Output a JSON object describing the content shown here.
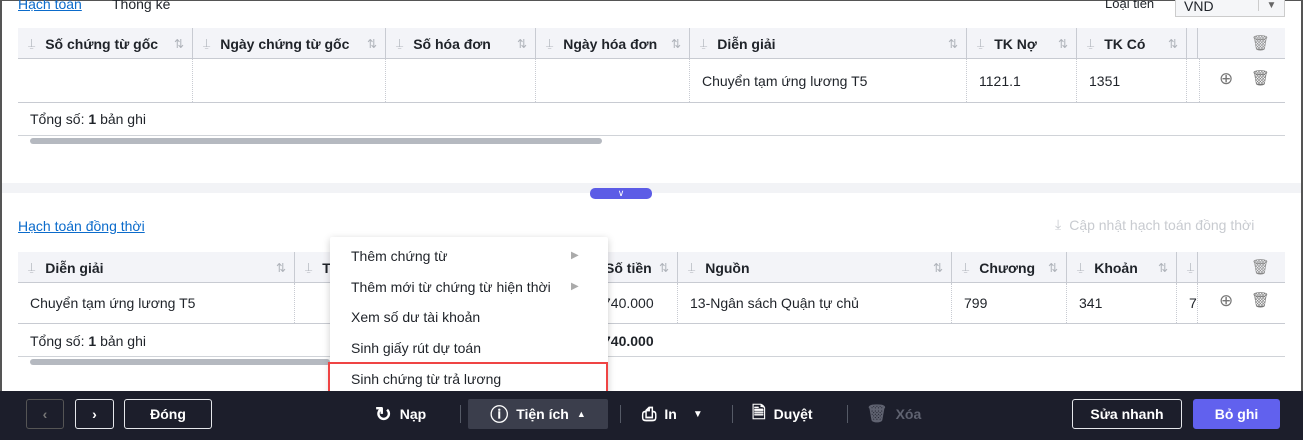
{
  "top": {
    "tabs": [
      "Hạch toán",
      "Thống kê"
    ],
    "currency_label": "Loại tiền",
    "currency_value": "VND",
    "columns": [
      "Số chứng từ gốc",
      "Ngày chứng từ gốc",
      "Số hóa đơn",
      "Ngày hóa đơn",
      "Diễn giải",
      "TK Nợ",
      "TK Có"
    ],
    "row": {
      "dien_giai": "Chuyển tạm ứng lương T5",
      "tk_no": "1121.1",
      "tk_co": "1351"
    },
    "footer_prefix": "Tổng số:",
    "footer_count": "1",
    "footer_suffix": "bản ghi"
  },
  "bottom": {
    "title": "Hạch toán đồng thời",
    "update_button": "Cập nhật hạch toán đồng thời",
    "columns": [
      "Diễn giải",
      "T",
      "Số tiền",
      "Nguồn",
      "Chương",
      "Khoản"
    ],
    "row": {
      "dien_giai": "Chuyển tạm ứng lương T5",
      "so_tien": "740.000",
      "nguon": "13-Ngân sách Quận tự chủ",
      "chuong": "799",
      "khoan": "341",
      "partial": "7"
    },
    "footer_prefix": "Tổng số:",
    "footer_count": "1",
    "footer_suffix": "bản ghi",
    "footer_total": "740.000"
  },
  "menu": {
    "items": [
      "Thêm chứng từ",
      "Thêm mới từ chứng từ hiện thời",
      "Xem số dư tài khoản",
      "Sinh giấy rút dự toán",
      "Sinh chứng từ trả lương"
    ],
    "highlighted": "Sinh chứng từ trả lương"
  },
  "toolbar": {
    "close": "Đóng",
    "reload": "Nạp",
    "utilities": "Tiện ích",
    "print": "In",
    "approve": "Duyệt",
    "delete": "Xóa",
    "quick_edit": "Sửa nhanh",
    "unpost": "Bỏ ghi"
  },
  "colors": {
    "accent": "#5c5ce6",
    "toolbar_bg": "#1c1e2b",
    "highlight_border": "#ef4444",
    "link": "#0b6bcb"
  }
}
